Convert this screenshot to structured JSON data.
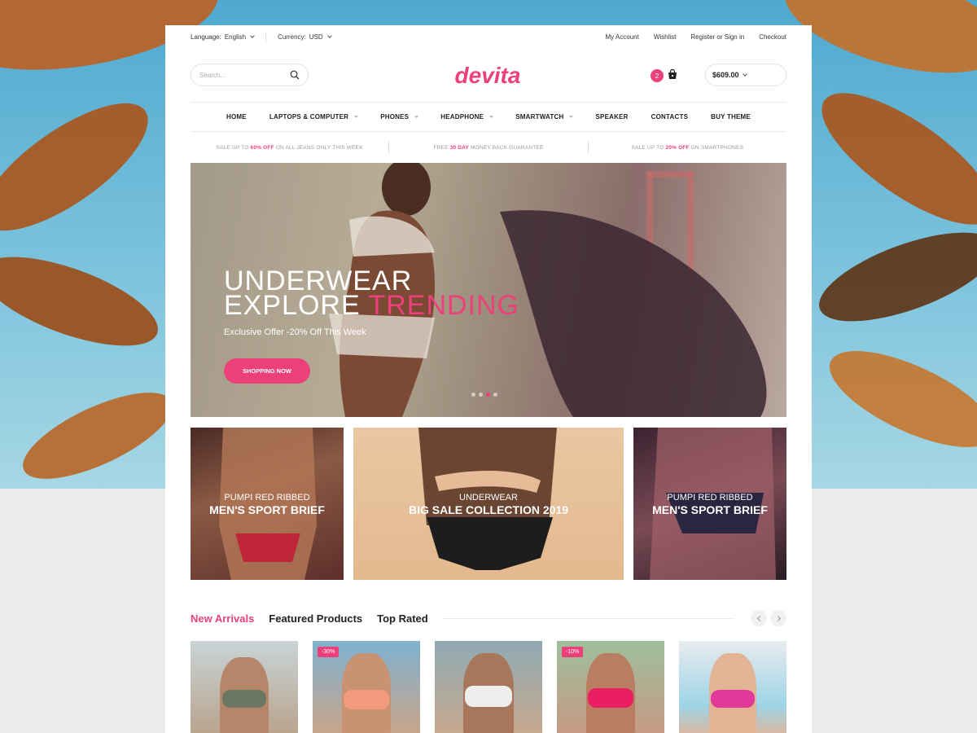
{
  "topbar": {
    "language_label": "Language:",
    "language_value": "English",
    "currency_label": "Currency:",
    "currency_value": "USD",
    "links": [
      "My Account",
      "Wishlist",
      "Register or Sign in",
      "Checkout"
    ]
  },
  "header": {
    "search_placeholder": "Search...",
    "logo_text": "devita",
    "cart_count": "2",
    "cart_total": "$609.00"
  },
  "nav": {
    "items": [
      {
        "label": "HOME",
        "dropdown": false
      },
      {
        "label": "LAPTOPS & COMPUTER",
        "dropdown": true
      },
      {
        "label": "PHONES",
        "dropdown": true
      },
      {
        "label": "HEADPHONE",
        "dropdown": true
      },
      {
        "label": "SMARTWATCH",
        "dropdown": true
      },
      {
        "label": "SPEAKER",
        "dropdown": false
      },
      {
        "label": "CONTACTS",
        "dropdown": false
      },
      {
        "label": "BUY THEME",
        "dropdown": false
      }
    ]
  },
  "promos": [
    {
      "pre": "SALE UP TO ",
      "hl": "60% OFF",
      "post": " ON ALL JEANS ONLY THIS WEEK"
    },
    {
      "pre": "FREE ",
      "hl": "30 DAY",
      "post": " MONEY BACK GUARANTEE"
    },
    {
      "pre": "SALE UP TO ",
      "hl": "20% OFF",
      "post": " ON SMARTPHONES"
    }
  ],
  "hero": {
    "line1": "UNDERWEAR",
    "line2_white": "EXPLORE ",
    "line2_pink": "TRENDING",
    "subtitle": "Exclusive Offer -20% Off This Week",
    "button": "SHOPPING NOW",
    "slide_count": 4,
    "active_slide": 2
  },
  "banners": [
    {
      "sub": "PUMPI RED RIBBED",
      "title": "MEN'S SPORT BRIEF"
    },
    {
      "sub": "UNDERWEAR",
      "title": "BIG SALE COLLECTION 2019"
    },
    {
      "sub": "PUMPI RED RIBBED",
      "title": "MEN'S SPORT BRIEF"
    }
  ],
  "tabs": [
    "New Arrivals",
    "Featured Products",
    "Top Rated"
  ],
  "products": [
    {
      "badge": ""
    },
    {
      "badge": "-30%"
    },
    {
      "badge": ""
    },
    {
      "badge": "-10%"
    },
    {
      "badge": ""
    }
  ],
  "colors": {
    "accent": "#ec407a"
  }
}
